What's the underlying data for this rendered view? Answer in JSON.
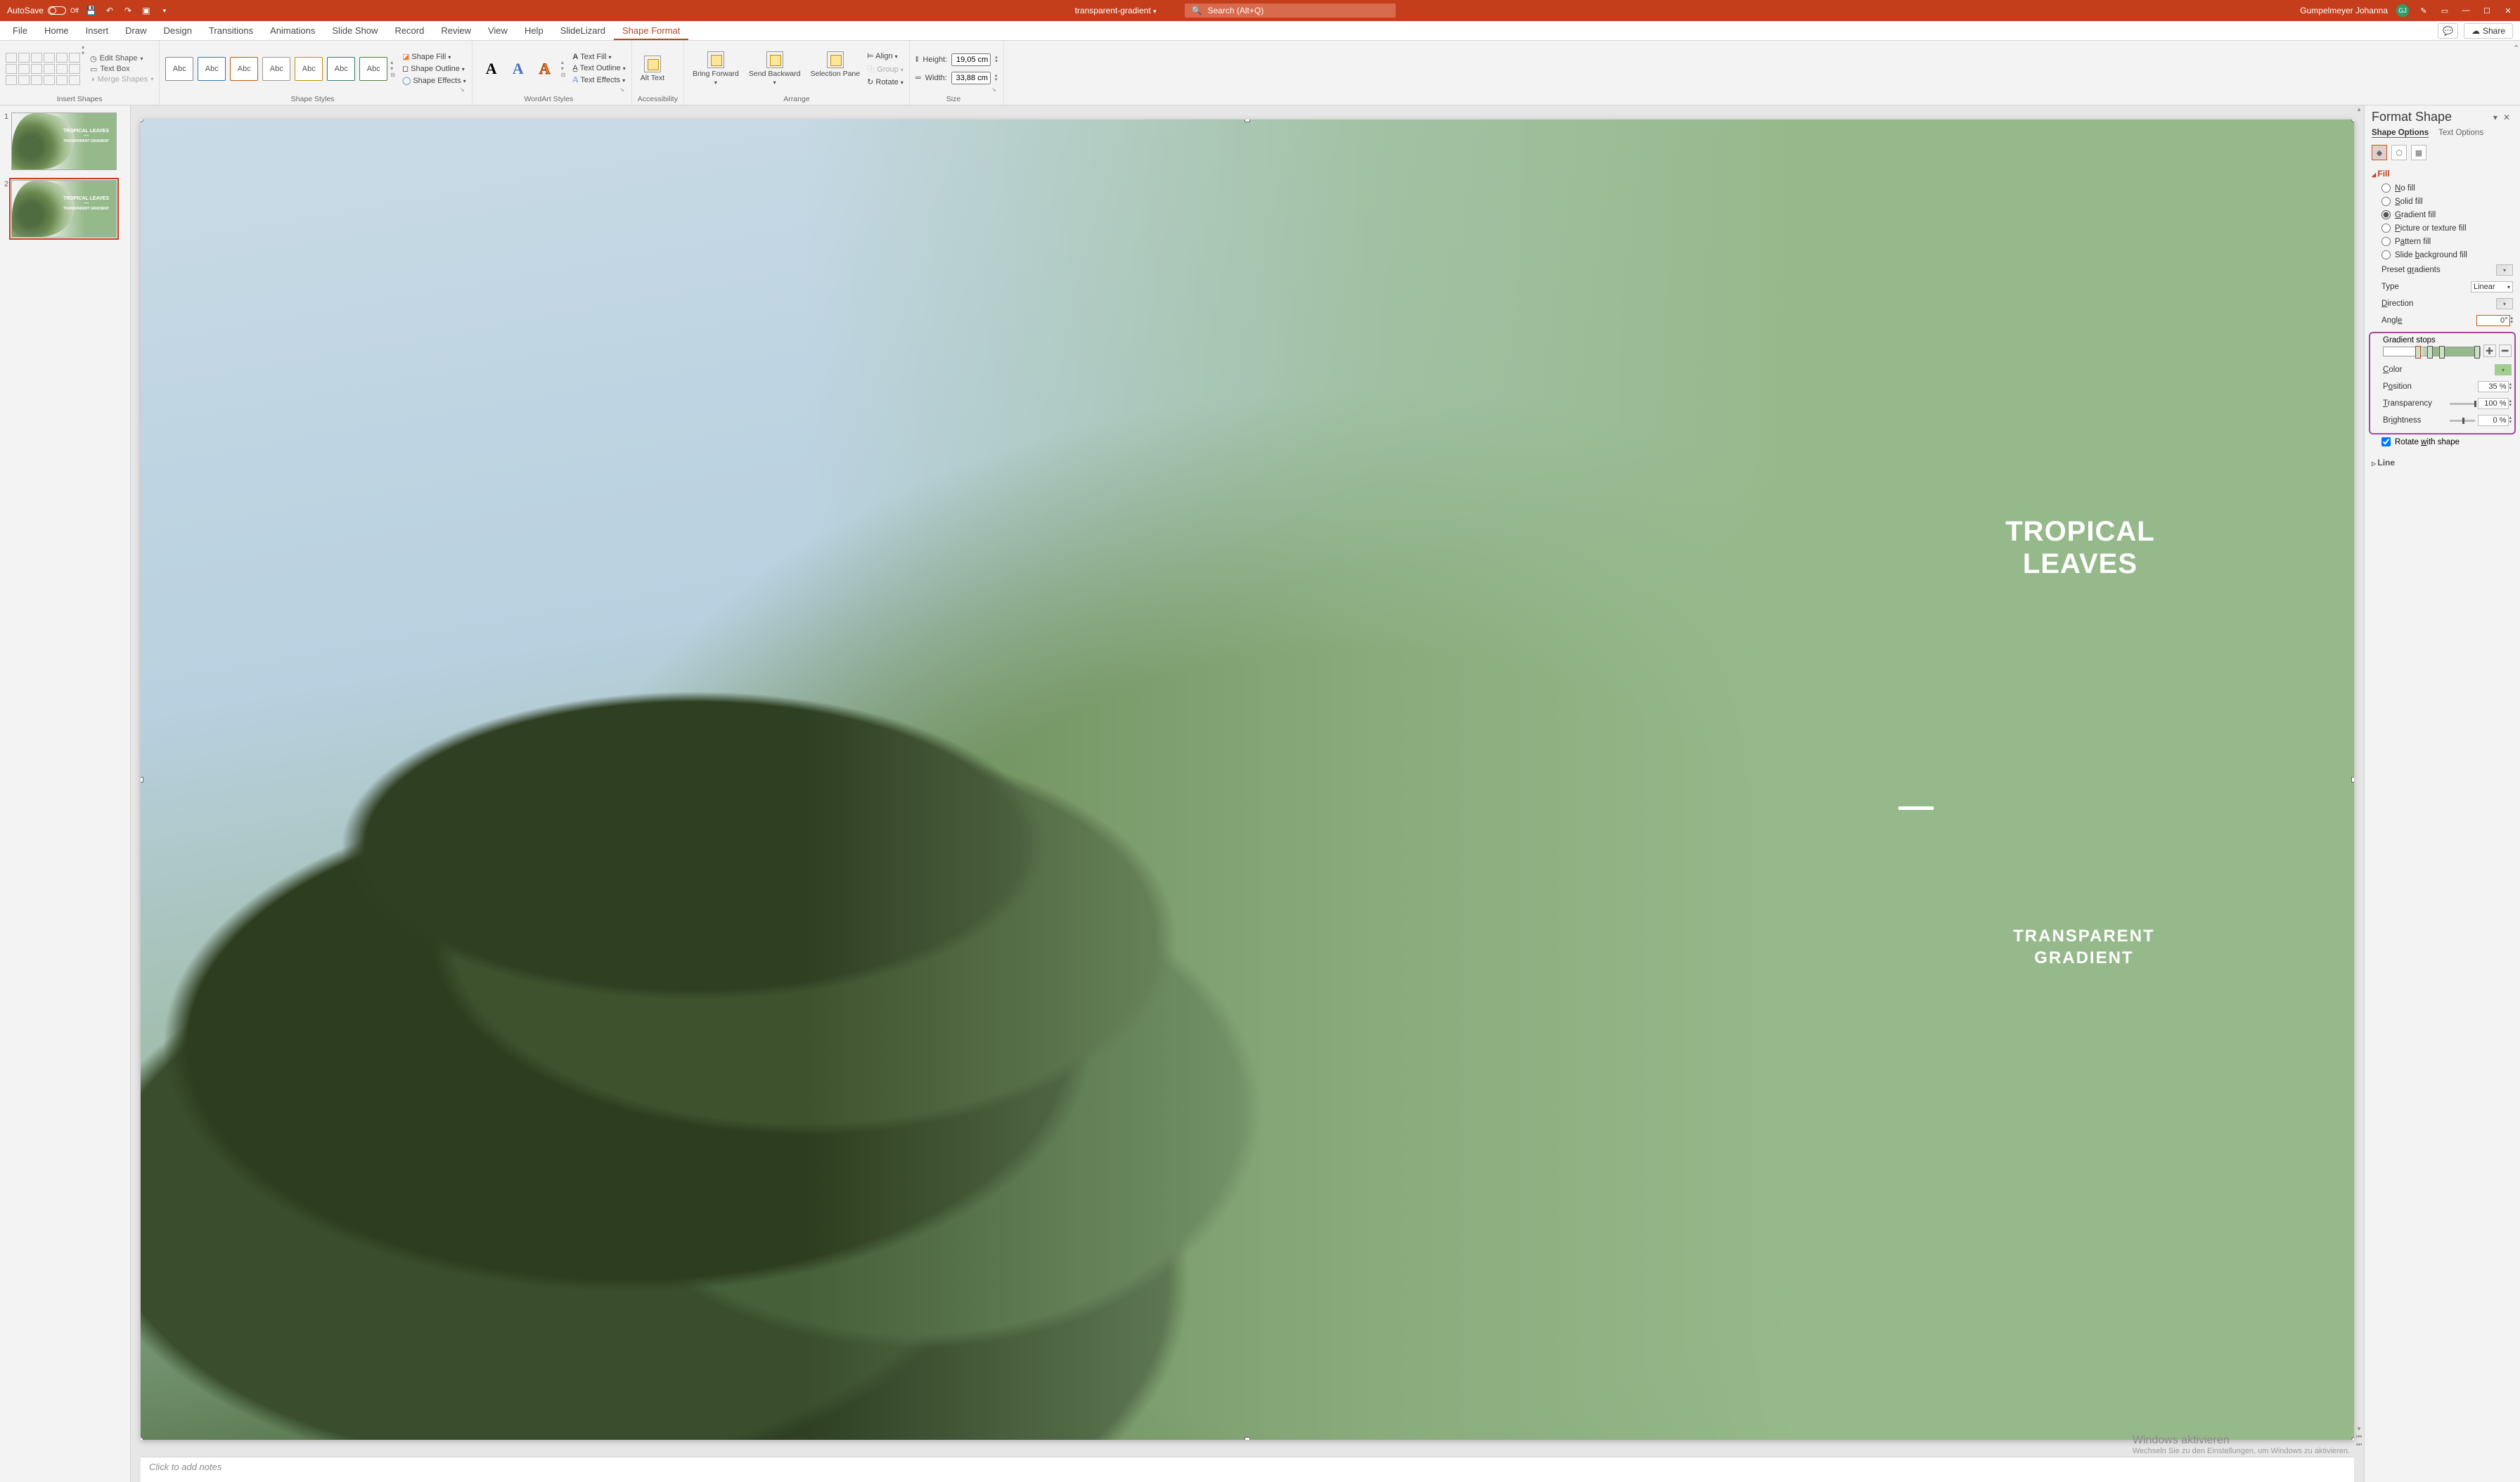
{
  "titlebar": {
    "autosave_label": "AutoSave",
    "autosave_state": "Off",
    "filename": "transparent-gradient",
    "search_placeholder": "Search (Alt+Q)",
    "username": "Gumpelmeyer Johanna",
    "avatar_initials": "GJ"
  },
  "ribbon_tabs": [
    "File",
    "Home",
    "Insert",
    "Draw",
    "Design",
    "Transitions",
    "Animations",
    "Slide Show",
    "Record",
    "Review",
    "View",
    "Help",
    "SlideLizard",
    "Shape Format"
  ],
  "active_tab": "Shape Format",
  "share_label": "Share",
  "groups": {
    "insert_shapes": {
      "label": "Insert Shapes",
      "edit_shape": "Edit Shape",
      "text_box": "Text Box",
      "merge_shapes": "Merge Shapes"
    },
    "shape_styles": {
      "label": "Shape Styles",
      "thumb_text": "Abc",
      "shape_fill": "Shape Fill",
      "shape_outline": "Shape Outline",
      "shape_effects": "Shape Effects"
    },
    "wordart": {
      "label": "WordArt Styles",
      "text_fill": "Text Fill",
      "text_outline": "Text Outline",
      "text_effects": "Text Effects"
    },
    "accessibility": {
      "label": "Accessibility",
      "alt_text": "Alt Text"
    },
    "arrange": {
      "label": "Arrange",
      "bring_forward": "Bring Forward",
      "send_backward": "Send Backward",
      "selection_pane": "Selection Pane",
      "align": "Align",
      "group": "Group",
      "rotate": "Rotate"
    },
    "size": {
      "label": "Size",
      "height_label": "Height:",
      "height_value": "19,05 cm",
      "width_label": "Width:",
      "width_value": "33,88 cm"
    }
  },
  "thumbnails": [
    {
      "num": "1",
      "title": "TROPICAL LEAVES",
      "sub": "TRANSPARENT GRADIENT"
    },
    {
      "num": "2",
      "title": "TROPICAL LEAVES",
      "sub": "TRANSPARENT GRADIENT"
    }
  ],
  "slide": {
    "title_l1": "TROPICAL",
    "title_l2": "LEAVES",
    "sub_l1": "TRANSPARENT",
    "sub_l2": "GRADIENT"
  },
  "notes_placeholder": "Click to add notes",
  "format_pane": {
    "title": "Format Shape",
    "tab_shape": "Shape Options",
    "tab_text": "Text Options",
    "section_fill": "Fill",
    "radios": {
      "no_fill": "No fill",
      "solid": "Solid fill",
      "gradient": "Gradient fill",
      "picture": "Picture or texture fill",
      "pattern": "Pattern fill",
      "slidebg": "Slide background fill"
    },
    "preset_gradients": "Preset gradients",
    "type": "Type",
    "type_value": "Linear",
    "direction": "Direction",
    "angle": "Angle",
    "angle_value": "0°",
    "grad_stops": "Gradient stops",
    "color": "Color",
    "position": "Position",
    "position_value": "35 %",
    "transparency": "Transparency",
    "transparency_value": "100 %",
    "brightness": "Brightness",
    "brightness_value": "0 %",
    "rotate_with_shape": "Rotate with shape",
    "section_line": "Line"
  },
  "watermark": {
    "l1": "Windows aktivieren",
    "l2": "Wechseln Sie zu den Einstellungen, um Windows zu aktivieren."
  }
}
